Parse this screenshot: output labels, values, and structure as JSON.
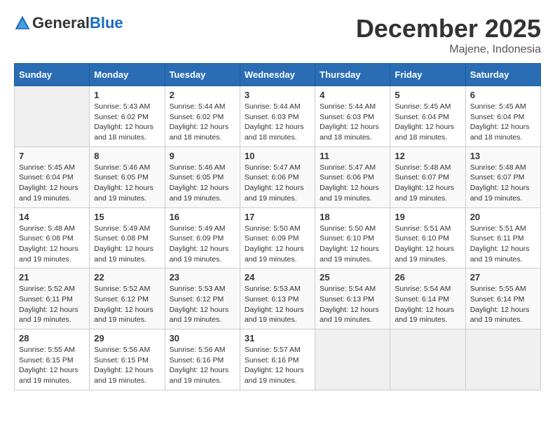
{
  "logo": {
    "general": "General",
    "blue": "Blue"
  },
  "title": "December 2025",
  "location": "Majene, Indonesia",
  "days_header": [
    "Sunday",
    "Monday",
    "Tuesday",
    "Wednesday",
    "Thursday",
    "Friday",
    "Saturday"
  ],
  "weeks": [
    [
      {
        "day": "",
        "info": ""
      },
      {
        "day": "1",
        "info": "Sunrise: 5:43 AM\nSunset: 6:02 PM\nDaylight: 12 hours\nand 18 minutes."
      },
      {
        "day": "2",
        "info": "Sunrise: 5:44 AM\nSunset: 6:02 PM\nDaylight: 12 hours\nand 18 minutes."
      },
      {
        "day": "3",
        "info": "Sunrise: 5:44 AM\nSunset: 6:03 PM\nDaylight: 12 hours\nand 18 minutes."
      },
      {
        "day": "4",
        "info": "Sunrise: 5:44 AM\nSunset: 6:03 PM\nDaylight: 12 hours\nand 18 minutes."
      },
      {
        "day": "5",
        "info": "Sunrise: 5:45 AM\nSunset: 6:04 PM\nDaylight: 12 hours\nand 18 minutes."
      },
      {
        "day": "6",
        "info": "Sunrise: 5:45 AM\nSunset: 6:04 PM\nDaylight: 12 hours\nand 18 minutes."
      }
    ],
    [
      {
        "day": "7",
        "info": "Sunrise: 5:45 AM\nSunset: 6:04 PM\nDaylight: 12 hours\nand 19 minutes."
      },
      {
        "day": "8",
        "info": "Sunrise: 5:46 AM\nSunset: 6:05 PM\nDaylight: 12 hours\nand 19 minutes."
      },
      {
        "day": "9",
        "info": "Sunrise: 5:46 AM\nSunset: 6:05 PM\nDaylight: 12 hours\nand 19 minutes."
      },
      {
        "day": "10",
        "info": "Sunrise: 5:47 AM\nSunset: 6:06 PM\nDaylight: 12 hours\nand 19 minutes."
      },
      {
        "day": "11",
        "info": "Sunrise: 5:47 AM\nSunset: 6:06 PM\nDaylight: 12 hours\nand 19 minutes."
      },
      {
        "day": "12",
        "info": "Sunrise: 5:48 AM\nSunset: 6:07 PM\nDaylight: 12 hours\nand 19 minutes."
      },
      {
        "day": "13",
        "info": "Sunrise: 5:48 AM\nSunset: 6:07 PM\nDaylight: 12 hours\nand 19 minutes."
      }
    ],
    [
      {
        "day": "14",
        "info": "Sunrise: 5:48 AM\nSunset: 6:08 PM\nDaylight: 12 hours\nand 19 minutes."
      },
      {
        "day": "15",
        "info": "Sunrise: 5:49 AM\nSunset: 6:08 PM\nDaylight: 12 hours\nand 19 minutes."
      },
      {
        "day": "16",
        "info": "Sunrise: 5:49 AM\nSunset: 6:09 PM\nDaylight: 12 hours\nand 19 minutes."
      },
      {
        "day": "17",
        "info": "Sunrise: 5:50 AM\nSunset: 6:09 PM\nDaylight: 12 hours\nand 19 minutes."
      },
      {
        "day": "18",
        "info": "Sunrise: 5:50 AM\nSunset: 6:10 PM\nDaylight: 12 hours\nand 19 minutes."
      },
      {
        "day": "19",
        "info": "Sunrise: 5:51 AM\nSunset: 6:10 PM\nDaylight: 12 hours\nand 19 minutes."
      },
      {
        "day": "20",
        "info": "Sunrise: 5:51 AM\nSunset: 6:11 PM\nDaylight: 12 hours\nand 19 minutes."
      }
    ],
    [
      {
        "day": "21",
        "info": "Sunrise: 5:52 AM\nSunset: 6:11 PM\nDaylight: 12 hours\nand 19 minutes."
      },
      {
        "day": "22",
        "info": "Sunrise: 5:52 AM\nSunset: 6:12 PM\nDaylight: 12 hours\nand 19 minutes."
      },
      {
        "day": "23",
        "info": "Sunrise: 5:53 AM\nSunset: 6:12 PM\nDaylight: 12 hours\nand 19 minutes."
      },
      {
        "day": "24",
        "info": "Sunrise: 5:53 AM\nSunset: 6:13 PM\nDaylight: 12 hours\nand 19 minutes."
      },
      {
        "day": "25",
        "info": "Sunrise: 5:54 AM\nSunset: 6:13 PM\nDaylight: 12 hours\nand 19 minutes."
      },
      {
        "day": "26",
        "info": "Sunrise: 5:54 AM\nSunset: 6:14 PM\nDaylight: 12 hours\nand 19 minutes."
      },
      {
        "day": "27",
        "info": "Sunrise: 5:55 AM\nSunset: 6:14 PM\nDaylight: 12 hours\nand 19 minutes."
      }
    ],
    [
      {
        "day": "28",
        "info": "Sunrise: 5:55 AM\nSunset: 6:15 PM\nDaylight: 12 hours\nand 19 minutes."
      },
      {
        "day": "29",
        "info": "Sunrise: 5:56 AM\nSunset: 6:15 PM\nDaylight: 12 hours\nand 19 minutes."
      },
      {
        "day": "30",
        "info": "Sunrise: 5:56 AM\nSunset: 6:16 PM\nDaylight: 12 hours\nand 19 minutes."
      },
      {
        "day": "31",
        "info": "Sunrise: 5:57 AM\nSunset: 6:16 PM\nDaylight: 12 hours\nand 19 minutes."
      },
      {
        "day": "",
        "info": ""
      },
      {
        "day": "",
        "info": ""
      },
      {
        "day": "",
        "info": ""
      }
    ]
  ]
}
